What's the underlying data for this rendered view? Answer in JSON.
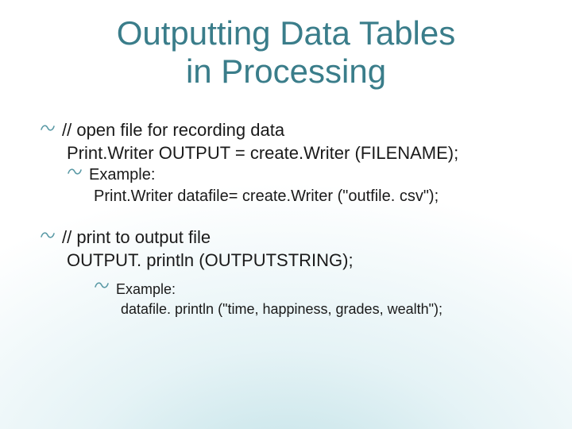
{
  "title_line1": "Outputting Data Tables",
  "title_line2": "in Processing",
  "b1": {
    "line1": "// open file for recording data",
    "line2": "Print.Writer OUTPUT = create.Writer (FILENAME);",
    "sub_label": "Example:",
    "sub_line": "Print.Writer datafile= create.Writer (\"outfile. csv\");"
  },
  "b2": {
    "line1": "// print to output file",
    "line2": "OUTPUT. println (OUTPUTSTRING);",
    "sub_label": "Example:",
    "sub_line": "datafile. println (\"time, happiness, grades, wealth\");"
  }
}
